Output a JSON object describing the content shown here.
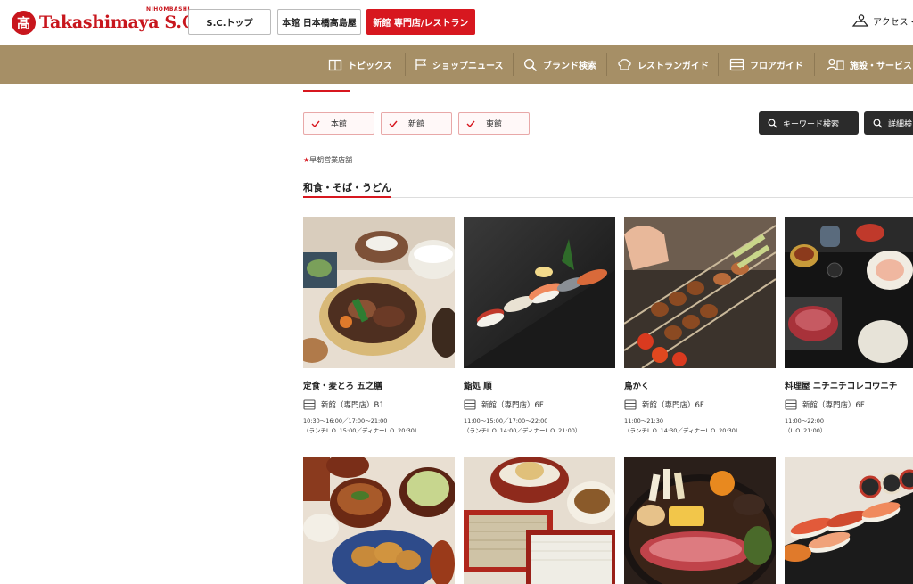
{
  "header": {
    "logo_mark": "髙",
    "logo_text": "Takashimaya",
    "logo_sub": "NIHOMBASHI",
    "logo_sc": "S.C.",
    "buttons": [
      {
        "label": "S.C.トップ"
      },
      {
        "label": "本館 日本橋高島屋"
      },
      {
        "label": "新館 専門店/レストラン"
      }
    ],
    "access_label": "アクセス・"
  },
  "nav": {
    "items": [
      {
        "label": "トピックス",
        "icon": "book-icon"
      },
      {
        "label": "ショップニュース",
        "icon": "flag-icon"
      },
      {
        "label": "ブランド検索",
        "icon": "search-icon"
      },
      {
        "label": "レストランガイド",
        "icon": "chef-hat-icon"
      },
      {
        "label": "フロアガイド",
        "icon": "floors-icon"
      },
      {
        "label": "施設・サービス",
        "icon": "people-icon"
      }
    ]
  },
  "filters": {
    "chips": [
      {
        "label": "本館"
      },
      {
        "label": "新館"
      },
      {
        "label": "東館"
      }
    ],
    "keyword_search": "キーワード検索",
    "detail_search": "詳細検"
  },
  "early_note": {
    "star": "★",
    "text": "早朝営業店舗"
  },
  "section": {
    "title": "和食・そば・うどん"
  },
  "cards": [
    {
      "name": "定食・麦とろ 五之膳",
      "location": "新館（専門店）B1",
      "hours1": "10:30～16:00／17:00～21:00",
      "hours2": "（ランチL.O. 15:00／ディナーL.O. 20:30）"
    },
    {
      "name": "鮨処 順",
      "location": "新館（専門店）6F",
      "hours1": "11:00～15:00／17:00～22:00",
      "hours2": "（ランチL.O. 14:00／ディナーL.O. 21:00）"
    },
    {
      "name": "鳥かく",
      "location": "新館（専門店）6F",
      "hours1": "11:00～21:30",
      "hours2": "（ランチL.O. 14:30／ディナーL.O. 20:30）"
    },
    {
      "name": "料理屋 ニチニチコレコウニチ",
      "location": "新館（専門店）6F",
      "hours1": "11:00～22:00",
      "hours2": "（L.O. 21:00）"
    }
  ],
  "colors": {
    "brand_red": "#d7171f",
    "nav_gold": "#a68f66",
    "dark_button": "#2b2b2b"
  }
}
